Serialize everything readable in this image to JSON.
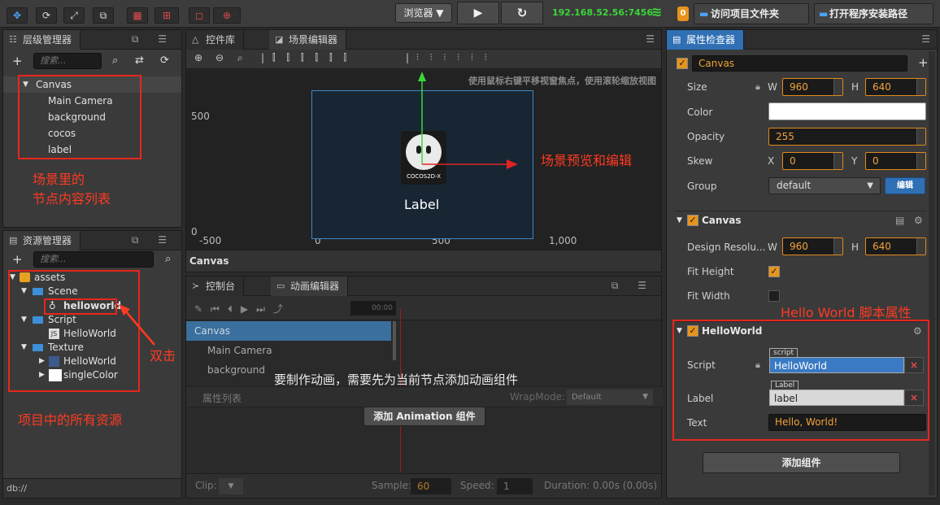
{
  "topbar": {
    "tools": [
      "✥",
      "⟳",
      "⤢",
      "⧉",
      "▦",
      "⊞",
      "◻",
      "⊕"
    ],
    "browser_select": "浏览器 ▼",
    "play": "▶",
    "refresh": "↻",
    "ip": "192.168.52.56:7456",
    "wifi": "≋",
    "badge": "0",
    "open_project_folder": "访问项目文件夹",
    "open_install_path": "打开程序安装路径"
  },
  "hierarchy": {
    "title": "层级管理器",
    "search_placeholder": "搜索...",
    "root": "Canvas",
    "nodes": [
      "Main Camera",
      "background",
      "cocos",
      "label"
    ],
    "annotation_line1": "场景里的",
    "annotation_line2": "节点内容列表"
  },
  "assets": {
    "title": "资源管理器",
    "search_placeholder": "搜索...",
    "root": "assets",
    "scene_folder": "Scene",
    "scene_item": "helloworld",
    "script_folder": "Script",
    "script_item": "HelloWorld",
    "texture_folder": "Texture",
    "texture_item1": "HelloWorld",
    "texture_item2": "singleColor",
    "annotation_dblclick": "双击",
    "annotation_all": "项目中的所有资源",
    "footer": "db://"
  },
  "scene": {
    "tab_widgets": "控件库",
    "tab_scene": "场景编辑器",
    "hint": "使用鼠标右键平移视窗焦点，使用滚轮缩放视图",
    "y500": "500",
    "y0": "0",
    "x_minus500": "-500",
    "x0": "0",
    "x500": "500",
    "x1000": "1,000",
    "logo_text": "COCOS2D-X",
    "label_text": "Label",
    "annotation": "场景预览和编辑",
    "breadcrumb": "Canvas"
  },
  "bottom": {
    "tab_console": "控制台",
    "tab_anim": "动画编辑器",
    "time": "00:00",
    "nodes": [
      "Canvas",
      "Main Camera",
      "background"
    ],
    "overlay_msg": "要制作动画，需要先为当前节点添加动画组件",
    "prop_list": "属性列表",
    "wrapmode_label": "WrapMode:",
    "wrapmode_value": "Default",
    "add_anim_btn": "添加 Animation 组件",
    "clip_label": "Clip:",
    "sample_label": "Sample:",
    "sample_value": "60",
    "speed_label": "Speed:",
    "speed_value": "1",
    "duration": "Duration: 0.00s (0.00s)"
  },
  "inspector": {
    "title": "属性检查器",
    "node_name": "Canvas",
    "size_label": "Size",
    "w_label": "W",
    "h_label": "H",
    "size_w": "960",
    "size_h": "640",
    "color_label": "Color",
    "opacity_label": "Opacity",
    "opacity": "255",
    "skew_label": "Skew",
    "x_label": "X",
    "y_label": "Y",
    "skew_x": "0",
    "skew_y": "0",
    "group_label": "Group",
    "group_value": "default",
    "edit_btn": "编辑",
    "canvas_section": "Canvas",
    "design_res_label": "Design Resolu...",
    "design_w": "960",
    "design_h": "640",
    "fit_height_label": "Fit Height",
    "fit_width_label": "Fit Width",
    "annotation_hw": "Hello World 脚本属性",
    "hw_section": "HelloWorld",
    "script_label": "Script",
    "script_tag": "script",
    "script_value": "HelloWorld",
    "label_label": "Label",
    "label_tag": "Label",
    "label_value": "label",
    "text_label": "Text",
    "text_value": "Hello, World!",
    "add_component_btn": "添加组件"
  },
  "colors": {
    "accent": "#e8941c",
    "annotation": "#ff3a22",
    "selection": "#3a6f9e",
    "ip_green": "#3ad63a"
  }
}
